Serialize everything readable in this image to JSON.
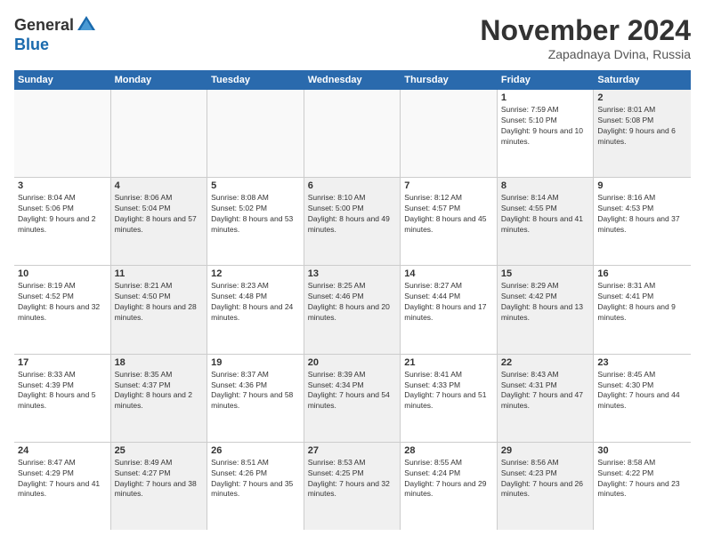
{
  "logo": {
    "general": "General",
    "blue": "Blue"
  },
  "title": "November 2024",
  "subtitle": "Zapadnaya Dvina, Russia",
  "days_of_week": [
    "Sunday",
    "Monday",
    "Tuesday",
    "Wednesday",
    "Thursday",
    "Friday",
    "Saturday"
  ],
  "rows": [
    [
      {
        "day": "",
        "info": "",
        "empty": true
      },
      {
        "day": "",
        "info": "",
        "empty": true
      },
      {
        "day": "",
        "info": "",
        "empty": true
      },
      {
        "day": "",
        "info": "",
        "empty": true
      },
      {
        "day": "",
        "info": "",
        "empty": true
      },
      {
        "day": "1",
        "info": "Sunrise: 7:59 AM\nSunset: 5:10 PM\nDaylight: 9 hours and 10 minutes.",
        "empty": false,
        "shaded": false
      },
      {
        "day": "2",
        "info": "Sunrise: 8:01 AM\nSunset: 5:08 PM\nDaylight: 9 hours and 6 minutes.",
        "empty": false,
        "shaded": true
      }
    ],
    [
      {
        "day": "3",
        "info": "Sunrise: 8:04 AM\nSunset: 5:06 PM\nDaylight: 9 hours and 2 minutes.",
        "empty": false,
        "shaded": false
      },
      {
        "day": "4",
        "info": "Sunrise: 8:06 AM\nSunset: 5:04 PM\nDaylight: 8 hours and 57 minutes.",
        "empty": false,
        "shaded": true
      },
      {
        "day": "5",
        "info": "Sunrise: 8:08 AM\nSunset: 5:02 PM\nDaylight: 8 hours and 53 minutes.",
        "empty": false,
        "shaded": false
      },
      {
        "day": "6",
        "info": "Sunrise: 8:10 AM\nSunset: 5:00 PM\nDaylight: 8 hours and 49 minutes.",
        "empty": false,
        "shaded": true
      },
      {
        "day": "7",
        "info": "Sunrise: 8:12 AM\nSunset: 4:57 PM\nDaylight: 8 hours and 45 minutes.",
        "empty": false,
        "shaded": false
      },
      {
        "day": "8",
        "info": "Sunrise: 8:14 AM\nSunset: 4:55 PM\nDaylight: 8 hours and 41 minutes.",
        "empty": false,
        "shaded": true
      },
      {
        "day": "9",
        "info": "Sunrise: 8:16 AM\nSunset: 4:53 PM\nDaylight: 8 hours and 37 minutes.",
        "empty": false,
        "shaded": false
      }
    ],
    [
      {
        "day": "10",
        "info": "Sunrise: 8:19 AM\nSunset: 4:52 PM\nDaylight: 8 hours and 32 minutes.",
        "empty": false,
        "shaded": false
      },
      {
        "day": "11",
        "info": "Sunrise: 8:21 AM\nSunset: 4:50 PM\nDaylight: 8 hours and 28 minutes.",
        "empty": false,
        "shaded": true
      },
      {
        "day": "12",
        "info": "Sunrise: 8:23 AM\nSunset: 4:48 PM\nDaylight: 8 hours and 24 minutes.",
        "empty": false,
        "shaded": false
      },
      {
        "day": "13",
        "info": "Sunrise: 8:25 AM\nSunset: 4:46 PM\nDaylight: 8 hours and 20 minutes.",
        "empty": false,
        "shaded": true
      },
      {
        "day": "14",
        "info": "Sunrise: 8:27 AM\nSunset: 4:44 PM\nDaylight: 8 hours and 17 minutes.",
        "empty": false,
        "shaded": false
      },
      {
        "day": "15",
        "info": "Sunrise: 8:29 AM\nSunset: 4:42 PM\nDaylight: 8 hours and 13 minutes.",
        "empty": false,
        "shaded": true
      },
      {
        "day": "16",
        "info": "Sunrise: 8:31 AM\nSunset: 4:41 PM\nDaylight: 8 hours and 9 minutes.",
        "empty": false,
        "shaded": false
      }
    ],
    [
      {
        "day": "17",
        "info": "Sunrise: 8:33 AM\nSunset: 4:39 PM\nDaylight: 8 hours and 5 minutes.",
        "empty": false,
        "shaded": false
      },
      {
        "day": "18",
        "info": "Sunrise: 8:35 AM\nSunset: 4:37 PM\nDaylight: 8 hours and 2 minutes.",
        "empty": false,
        "shaded": true
      },
      {
        "day": "19",
        "info": "Sunrise: 8:37 AM\nSunset: 4:36 PM\nDaylight: 7 hours and 58 minutes.",
        "empty": false,
        "shaded": false
      },
      {
        "day": "20",
        "info": "Sunrise: 8:39 AM\nSunset: 4:34 PM\nDaylight: 7 hours and 54 minutes.",
        "empty": false,
        "shaded": true
      },
      {
        "day": "21",
        "info": "Sunrise: 8:41 AM\nSunset: 4:33 PM\nDaylight: 7 hours and 51 minutes.",
        "empty": false,
        "shaded": false
      },
      {
        "day": "22",
        "info": "Sunrise: 8:43 AM\nSunset: 4:31 PM\nDaylight: 7 hours and 47 minutes.",
        "empty": false,
        "shaded": true
      },
      {
        "day": "23",
        "info": "Sunrise: 8:45 AM\nSunset: 4:30 PM\nDaylight: 7 hours and 44 minutes.",
        "empty": false,
        "shaded": false
      }
    ],
    [
      {
        "day": "24",
        "info": "Sunrise: 8:47 AM\nSunset: 4:29 PM\nDaylight: 7 hours and 41 minutes.",
        "empty": false,
        "shaded": false
      },
      {
        "day": "25",
        "info": "Sunrise: 8:49 AM\nSunset: 4:27 PM\nDaylight: 7 hours and 38 minutes.",
        "empty": false,
        "shaded": true
      },
      {
        "day": "26",
        "info": "Sunrise: 8:51 AM\nSunset: 4:26 PM\nDaylight: 7 hours and 35 minutes.",
        "empty": false,
        "shaded": false
      },
      {
        "day": "27",
        "info": "Sunrise: 8:53 AM\nSunset: 4:25 PM\nDaylight: 7 hours and 32 minutes.",
        "empty": false,
        "shaded": true
      },
      {
        "day": "28",
        "info": "Sunrise: 8:55 AM\nSunset: 4:24 PM\nDaylight: 7 hours and 29 minutes.",
        "empty": false,
        "shaded": false
      },
      {
        "day": "29",
        "info": "Sunrise: 8:56 AM\nSunset: 4:23 PM\nDaylight: 7 hours and 26 minutes.",
        "empty": false,
        "shaded": true
      },
      {
        "day": "30",
        "info": "Sunrise: 8:58 AM\nSunset: 4:22 PM\nDaylight: 7 hours and 23 minutes.",
        "empty": false,
        "shaded": false
      }
    ]
  ]
}
